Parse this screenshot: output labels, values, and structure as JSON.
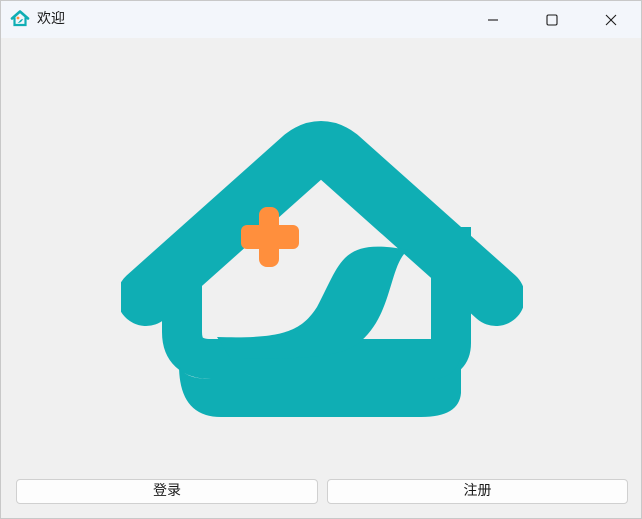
{
  "window": {
    "title": "欢迎",
    "icon": "house-leaf-icon"
  },
  "controls": {
    "minimize_icon": "minimize-icon",
    "maximize_icon": "maximize-icon",
    "close_icon": "close-icon"
  },
  "logo": {
    "icon": "house-medical-leaf-logo",
    "colors": {
      "house": "#0faeb4",
      "cross": "#ff8f3d"
    }
  },
  "actions": {
    "login_label": "登录",
    "register_label": "注册"
  }
}
